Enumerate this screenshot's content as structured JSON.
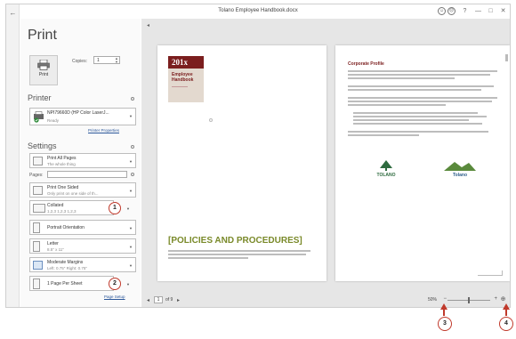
{
  "window": {
    "title": "Tolano Employee Handbook.docx",
    "controls": [
      "?",
      "—",
      "□",
      "✕"
    ]
  },
  "panel": {
    "title": "Print",
    "print_button": "Print",
    "copies_label": "Copies:",
    "copies_value": "1",
    "printer_heading": "Printer",
    "printer_name": "NPI79660D (HP Color LaserJ...",
    "printer_status": "Ready",
    "printer_properties": "Printer Properties",
    "settings_heading": "Settings",
    "pages_label": "Pages:",
    "page_setup": "Page Setup",
    "settings": [
      {
        "line1": "Print All Pages",
        "line2": "The whole thing"
      },
      {
        "line1": "Print One Sided",
        "line2": "Only print on one side of th..."
      },
      {
        "line1": "Collated",
        "line2": "1,2,3   1,2,3   1,2,3"
      },
      {
        "line1": "Portrait Orientation",
        "line2": ""
      },
      {
        "line1": "Letter",
        "line2": "8.5\" x 11\""
      },
      {
        "line1": "Moderate Margins",
        "line2": "Left: 0.75\"   Right: 0.75\""
      },
      {
        "line1": "1 Page Per Sheet",
        "line2": ""
      }
    ]
  },
  "preview": {
    "page1": {
      "year": "201x",
      "handbook_title": "Employee Handbook",
      "heading": "[POLICIES AND PROCEDURES]"
    },
    "page2": {
      "heading": "Corporate Profile",
      "logo_left": "TOLANO",
      "logo_right": "Tolano"
    },
    "page_current": "1",
    "page_total": "of 9",
    "zoom": "50%",
    "zoom_level": 0.5
  },
  "callouts": [
    "1",
    "2",
    "3",
    "4"
  ],
  "colors": {
    "accent_red": "#7b1e1e",
    "heading_green": "#7a8a2a",
    "callout_red": "#c0392b",
    "link_blue": "#2b579a"
  }
}
